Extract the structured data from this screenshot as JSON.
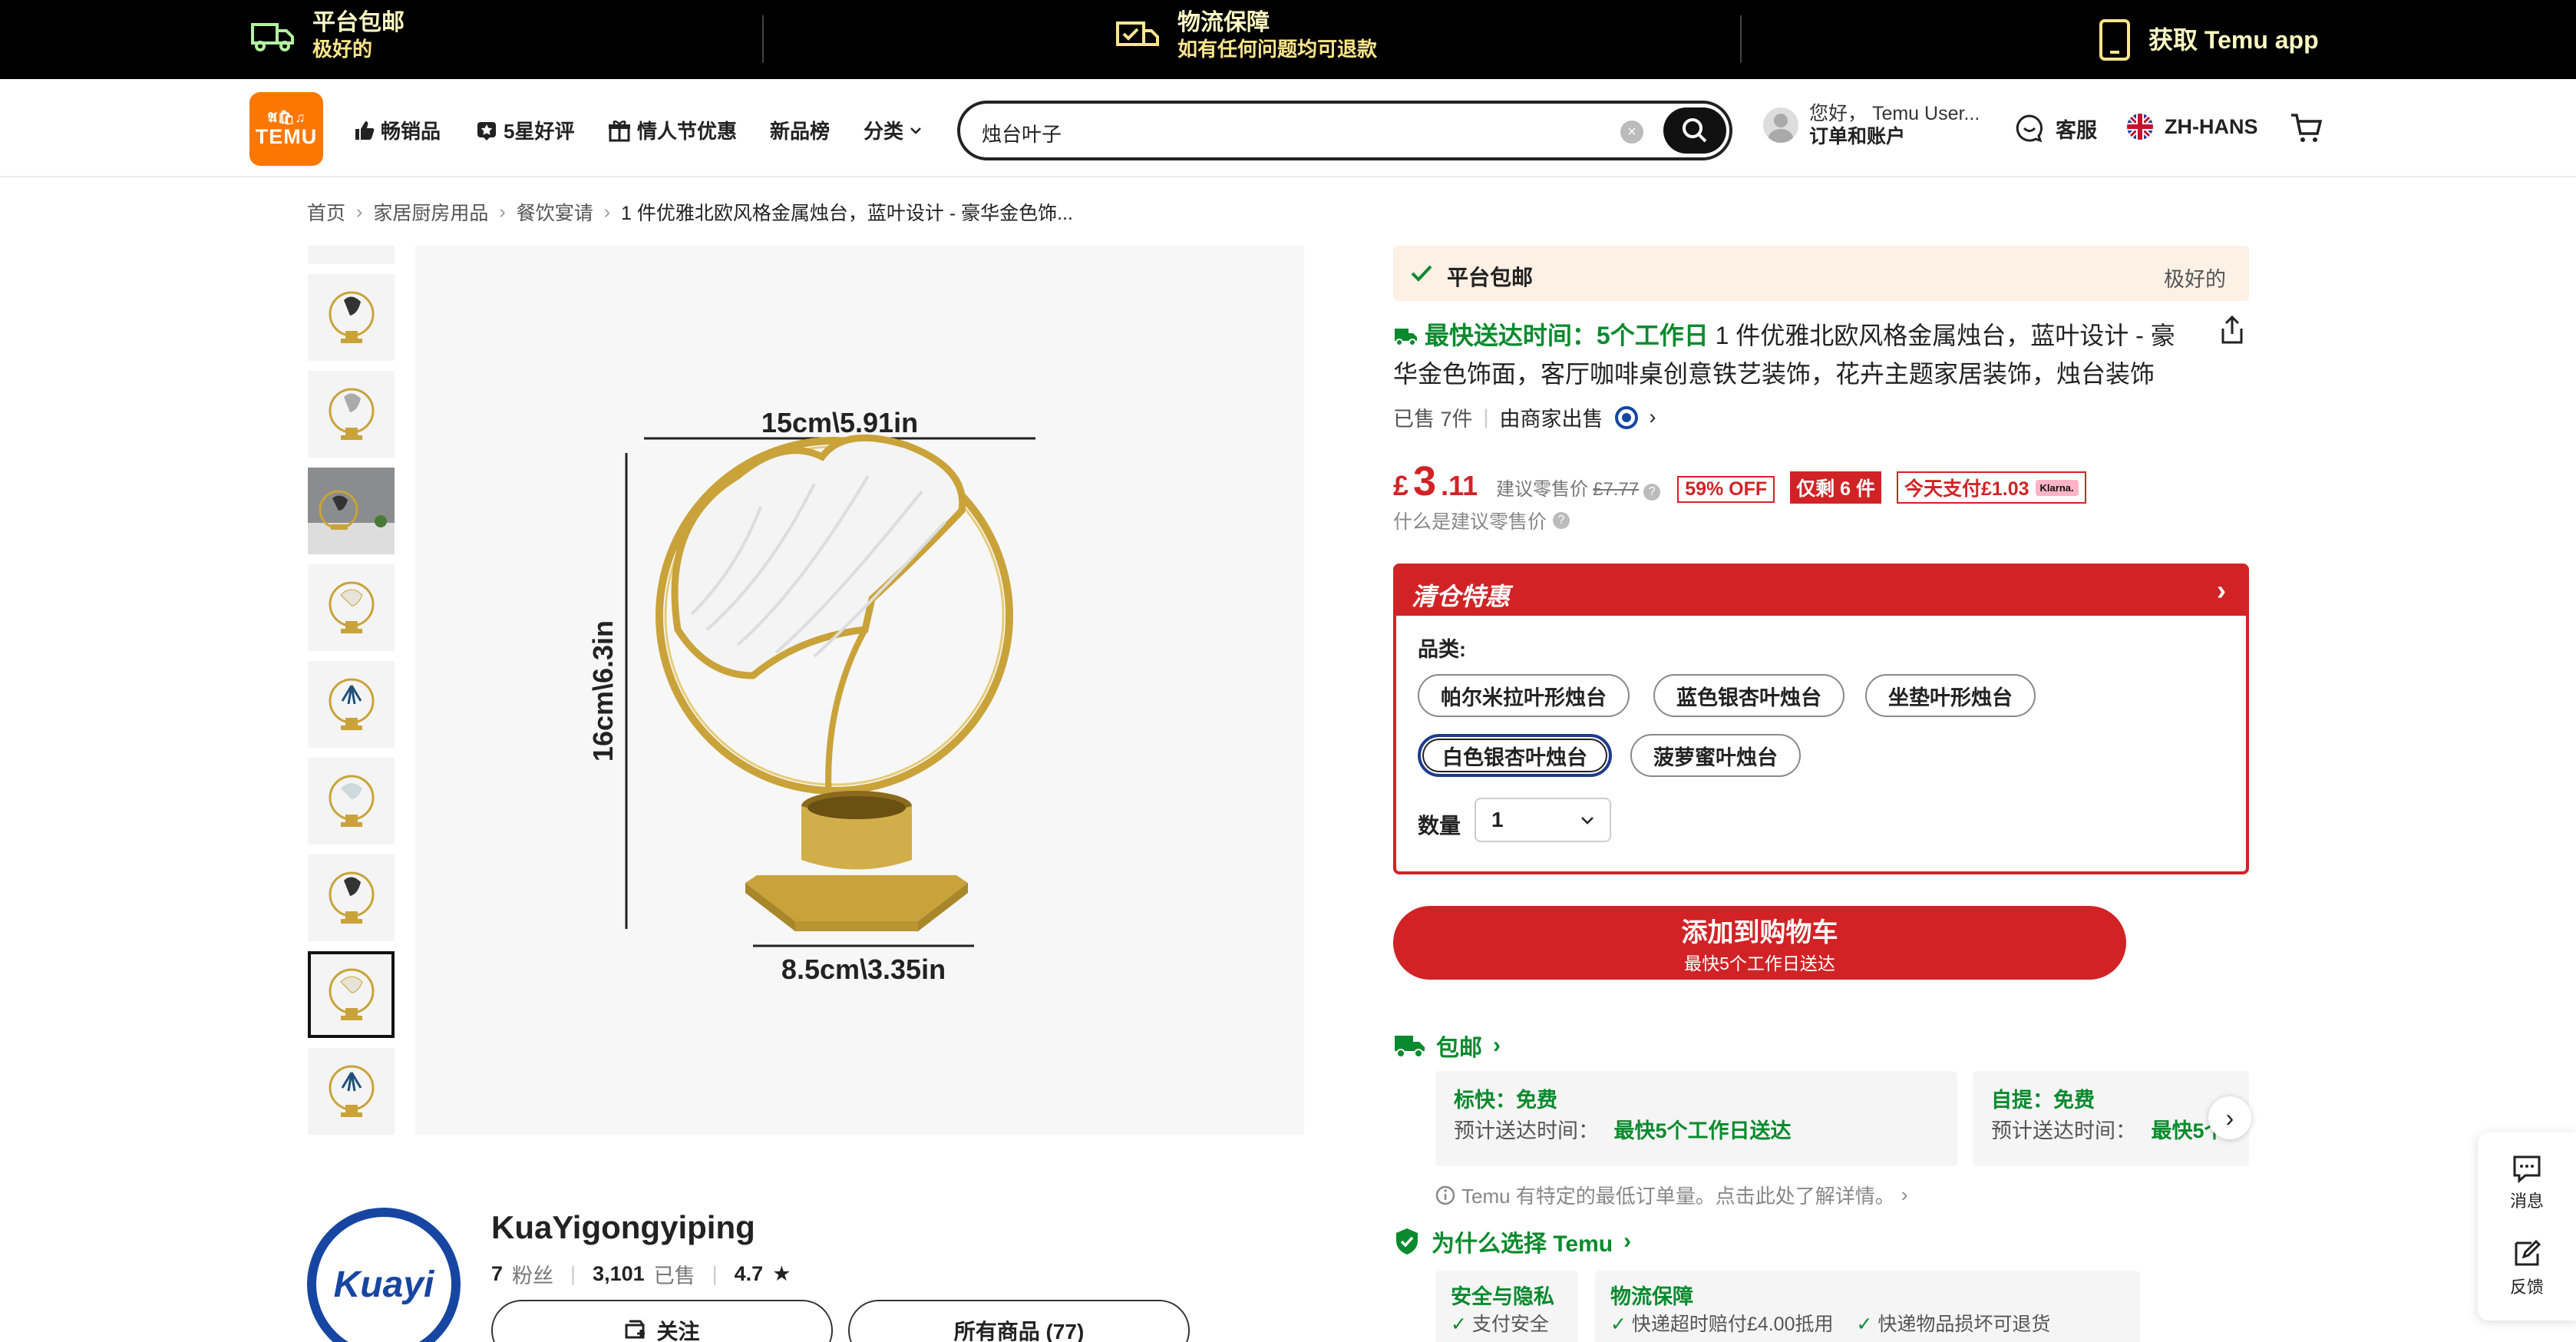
{
  "topbar": {
    "free_shipping_title": "平台包邮",
    "free_shipping_sub": "极好的",
    "logistics_title": "物流保障",
    "logistics_sub": "如有任何问题均可退款",
    "app_label": "获取 Temu app"
  },
  "header": {
    "logo_top": "𝕬🛍♫",
    "logo_text": "TEMU",
    "nav": {
      "bestsellers": "畅销品",
      "five_star": "5星好评",
      "valentines": "情人节优惠",
      "new_arrivals": "新品榜",
      "categories": "分类"
    },
    "search_value": "烛台叶子",
    "greeting": "您好， Temu User...",
    "account": "订单和账户",
    "support": "客服",
    "language": "ZH-HANS"
  },
  "breadcrumb": [
    "首页",
    "家居厨房用品",
    "餐饮宴请",
    "1 件优雅北欧风格金属烛台，蓝叶设计 - 豪华金色饰..."
  ],
  "gallery": {
    "selected_index": 8,
    "image_labels": {
      "width_top": "15cm\\5.91in",
      "height": "16cm\\6.3in",
      "width_bottom": "8.5cm\\3.35in"
    }
  },
  "store": {
    "logo_text": "Kuayi",
    "name": "KuaYigongyiping",
    "followers_count": "7",
    "followers_label": "粉丝",
    "sold_count": "3,101",
    "sold_label": "已售",
    "rating": "4.7",
    "follow_label": "关注",
    "all_products_label": "所有商品 (77)"
  },
  "product": {
    "free_shipping": "平台包邮",
    "free_shipping_right": "极好的",
    "fastest_delivery": "最快送达时间：5个工作日",
    "title": "1 件优雅北欧风格金属烛台，蓝叶设计 - 豪华金色饰面，客厅咖啡桌创意铁艺装饰，花卉主题家居装饰，烛台装饰",
    "sold": "已售 7件",
    "seller": "由商家出售",
    "price_symbol": "£",
    "price_int": "3",
    "price_dec": ".11",
    "rrp_label": "建议零售价",
    "rrp_value": "£7.77",
    "discount": "59% OFF",
    "stock_left": "仅剩 6 件",
    "pay_today": "今天支付£1.03",
    "klarna": "Klarna.",
    "rrp_question": "什么是建议零售价"
  },
  "promo": {
    "title": "清仓特惠",
    "category_label": "品类:",
    "variants": [
      "帕尔米拉叶形烛台",
      "蓝色银杏叶烛台",
      "坐垫叶形烛台",
      "白色银杏叶烛台",
      "菠萝蜜叶烛台"
    ],
    "selected_variant": 3,
    "quantity_label": "数量",
    "quantity_value": "1"
  },
  "cart": {
    "button_label": "添加到购物车",
    "button_sub": "最快5个工作日送达"
  },
  "shipping": {
    "title": "包邮",
    "standard_title": "标快：免费",
    "standard_eta_label": "预计送达时间：",
    "standard_eta_value": "最快5个工作日送达",
    "pickup_title": "自提：免费",
    "pickup_eta_label": "预计送达时间：",
    "pickup_eta_value": "最快5个",
    "min_order_note": "Temu 有特定的最低订单量。点击此处了解详情。"
  },
  "why_temu": {
    "title": "为什么选择 Temu",
    "security_title": "安全与隐私",
    "security_item": "支付安全",
    "logistics_title": "物流保障",
    "logistics_item1": "快递超时赔付£4.00抵用",
    "logistics_item2": "快递物品损坏可退货"
  },
  "side_tools": {
    "messages": "消息",
    "feedback": "反馈"
  },
  "colors": {
    "accent_red": "#d12326",
    "accent_green": "#0a8a2e",
    "temu_orange": "#fb7701"
  }
}
